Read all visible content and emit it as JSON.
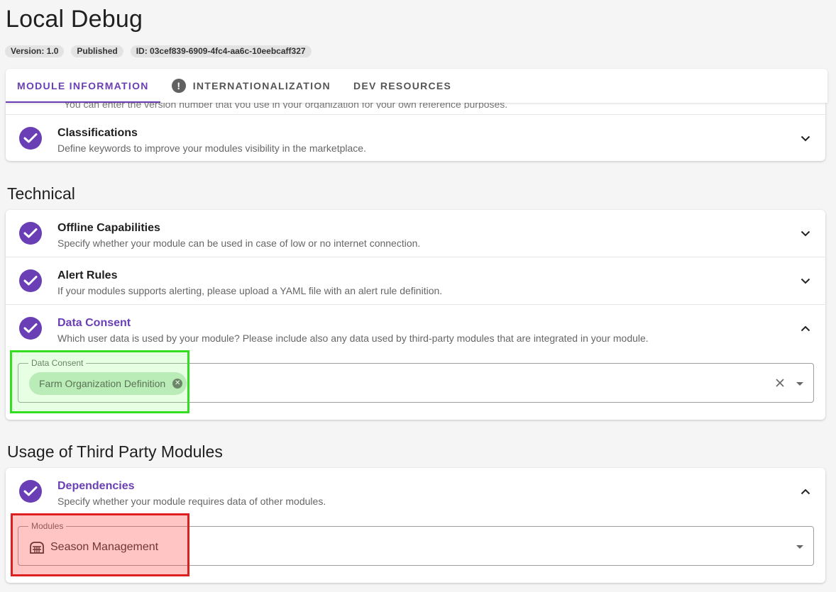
{
  "page": {
    "title": "Local Debug",
    "chips": [
      "Version: 1.0",
      "Published",
      "ID: 03cef839-6909-4fc4-aa6c-10eebcaff327"
    ]
  },
  "tabs": [
    {
      "label": "Module Information",
      "active": true,
      "icon": null
    },
    {
      "label": "Internationalization",
      "active": false,
      "icon": "warning-icon"
    },
    {
      "label": "Dev Resources",
      "active": false,
      "icon": null
    }
  ],
  "top_card": {
    "clipped_text": "You can enter the version number that you use in your organization for your own reference purposes.",
    "rows": [
      {
        "title": "Classifications",
        "description": "Define keywords to improve your modules visibility in the marketplace.",
        "expanded": false
      }
    ]
  },
  "technical": {
    "heading": "Technical",
    "rows": [
      {
        "title": "Offline Capabilities",
        "description": "Specify whether your module can be used in case of low or no internet connection.",
        "expanded": false
      },
      {
        "title": "Alert Rules",
        "description": "If your modules supports alerting, please upload a YAML file with an alert rule definition.",
        "expanded": false
      },
      {
        "title": "Data Consent",
        "description": "Which user data is used by your module? Please include also any data used by third-party modules that are integrated in your module.",
        "expanded": true
      }
    ],
    "data_consent_field": {
      "label": "Data Consent",
      "chips": [
        "Farm Organization Definition"
      ]
    }
  },
  "third_party": {
    "heading": "Usage of Third Party Modules",
    "rows": [
      {
        "title": "Dependencies",
        "description": "Specify whether your module requires data of other modules.",
        "expanded": true
      }
    ],
    "modules_field": {
      "label": "Modules",
      "value": "Season Management",
      "icon": "module-icon"
    }
  },
  "colors": {
    "accent": "#6a3fb5",
    "chip_green": "#c7e8c8",
    "highlight_green": "#33dd1f",
    "highlight_red": "#dd1f1f"
  }
}
